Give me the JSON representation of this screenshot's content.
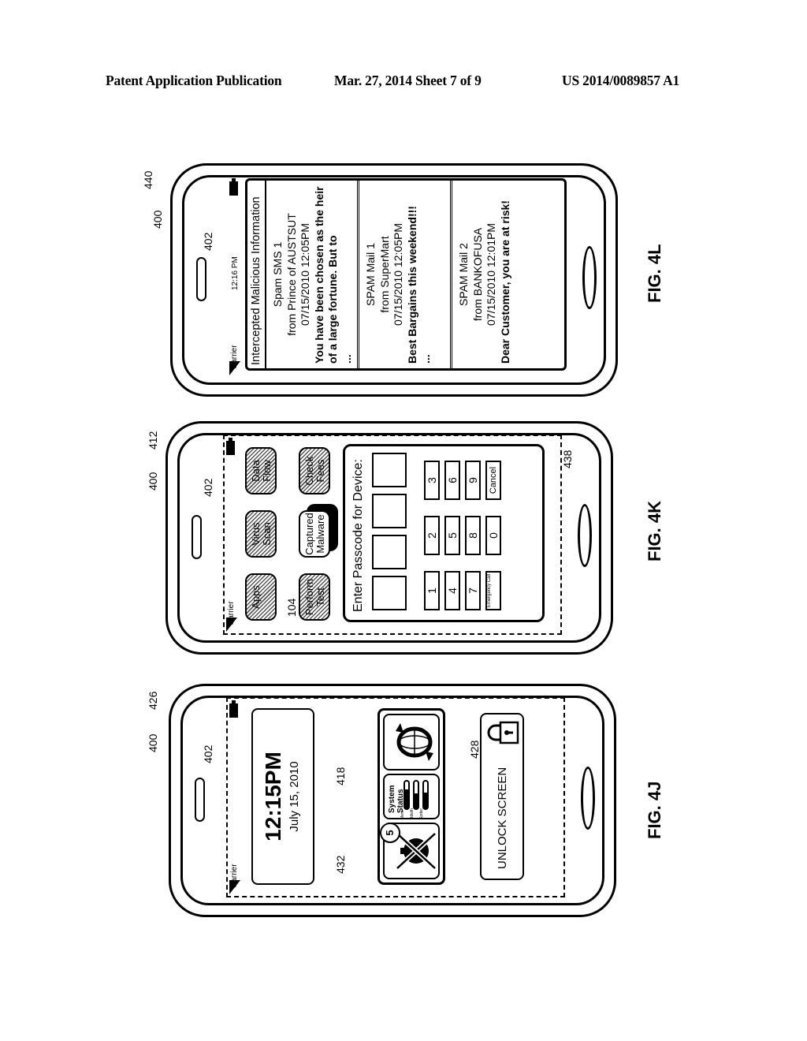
{
  "header": {
    "left": "Patent Application Publication",
    "middle": "Mar. 27, 2014  Sheet 7 of 9",
    "right": "US 2014/0089857 A1"
  },
  "figures": {
    "fig_4l": {
      "label": "FIG. 4L",
      "refs": {
        "device": "400",
        "screen": "402",
        "list": "440"
      },
      "status": {
        "carrier": "Carrier",
        "time": "12:16 PM"
      },
      "title": "Intercepted Malicious Information",
      "messages": [
        {
          "title": "Spam SMS 1",
          "from": "from Prince of AUSTSUT",
          "date": "07/15/2010 12:05PM",
          "body": "You have been chosen as the heir of a large fortune.  But to",
          "more": "..."
        },
        {
          "title": "SPAM Mail 1",
          "from": "from SuperMart",
          "date": "07/15/2010 12:05PM",
          "body": "Best Bargains this weekend!!!",
          "more": "..."
        },
        {
          "title": "SPAM Mail 2",
          "from": "from BANKOFUSA",
          "date": "07/15/2010 12:01PM",
          "body": "Dear Customer, you are at risk!",
          "more": ""
        }
      ]
    },
    "fig_4k": {
      "label": "FIG. 4K",
      "refs": {
        "device": "400",
        "screen": "402",
        "home": "412",
        "app": "104",
        "dialog": "438"
      },
      "status": {
        "carrier": "Carrier"
      },
      "apps": [
        "Apps",
        "Virus Scan",
        "Data Flow",
        "Perform Test",
        "Captured Malware",
        "Check Fees"
      ],
      "dialog_title": "Enter Passcode for Device:",
      "keys": [
        "1",
        "2",
        "3",
        "4",
        "5",
        "6",
        "7",
        "8",
        "9",
        "Emergency Call",
        "0",
        "Cancel"
      ]
    },
    "fig_4j": {
      "label": "FIG. 4J",
      "refs": {
        "device": "400",
        "screen": "402",
        "lock": "426",
        "widgets": "418",
        "malware_widget": "432",
        "unlock": "428"
      },
      "status": {
        "carrier": "Carrier"
      },
      "time": "12:15PM",
      "date": "July 15, 2010",
      "system_status": {
        "title": "System Status",
        "bars": [
          {
            "label": "Mem",
            "fill": 0.7
          },
          {
            "label": "Bdwth",
            "fill": 0.55
          },
          {
            "label": "Spdsc",
            "fill": 0.6
          }
        ]
      },
      "badge_count": "5",
      "unlock_label": "UNLOCK SCREEN"
    }
  }
}
